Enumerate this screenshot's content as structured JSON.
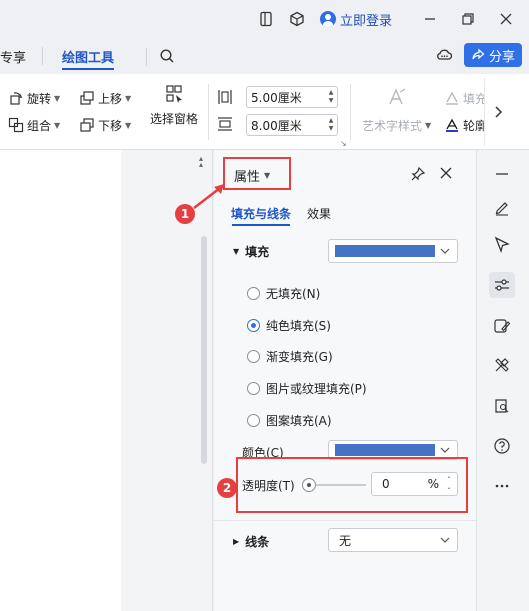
{
  "titlebar": {
    "login_label": "立即登录"
  },
  "tabs": {
    "prev_tab": "专享",
    "active_tab": "绘图工具",
    "share_label": "分享"
  },
  "ribbon": {
    "rotate": "旋转",
    "group": "组合",
    "move_up": "上移",
    "move_down": "下移",
    "selection_pane": "选择窗格",
    "width_value": "5.00厘米",
    "height_value": "8.00厘米",
    "art_style": "艺术字样式",
    "fill": "填充",
    "outline": "轮廓"
  },
  "panel": {
    "title": "属性",
    "tabs": [
      "填充与线条",
      "效果"
    ],
    "fill_section": "填充",
    "fill_options": [
      "无填充(N)",
      "纯色填充(S)",
      "渐变填充(G)",
      "图片或纹理填充(P)",
      "图案填充(A)"
    ],
    "selected_fill": "纯色填充(S)",
    "color_label": "颜色(C)",
    "transparency_label": "透明度(T)",
    "transparency_value": "0",
    "transparency_unit": "%",
    "line_section": "线条",
    "line_value": "无"
  },
  "annotations": {
    "badge1": "1",
    "badge2": "2"
  },
  "colors": {
    "fill_color": "#4472c4",
    "accent": "#2f6fe8",
    "annotation_red": "#e63f3f"
  }
}
